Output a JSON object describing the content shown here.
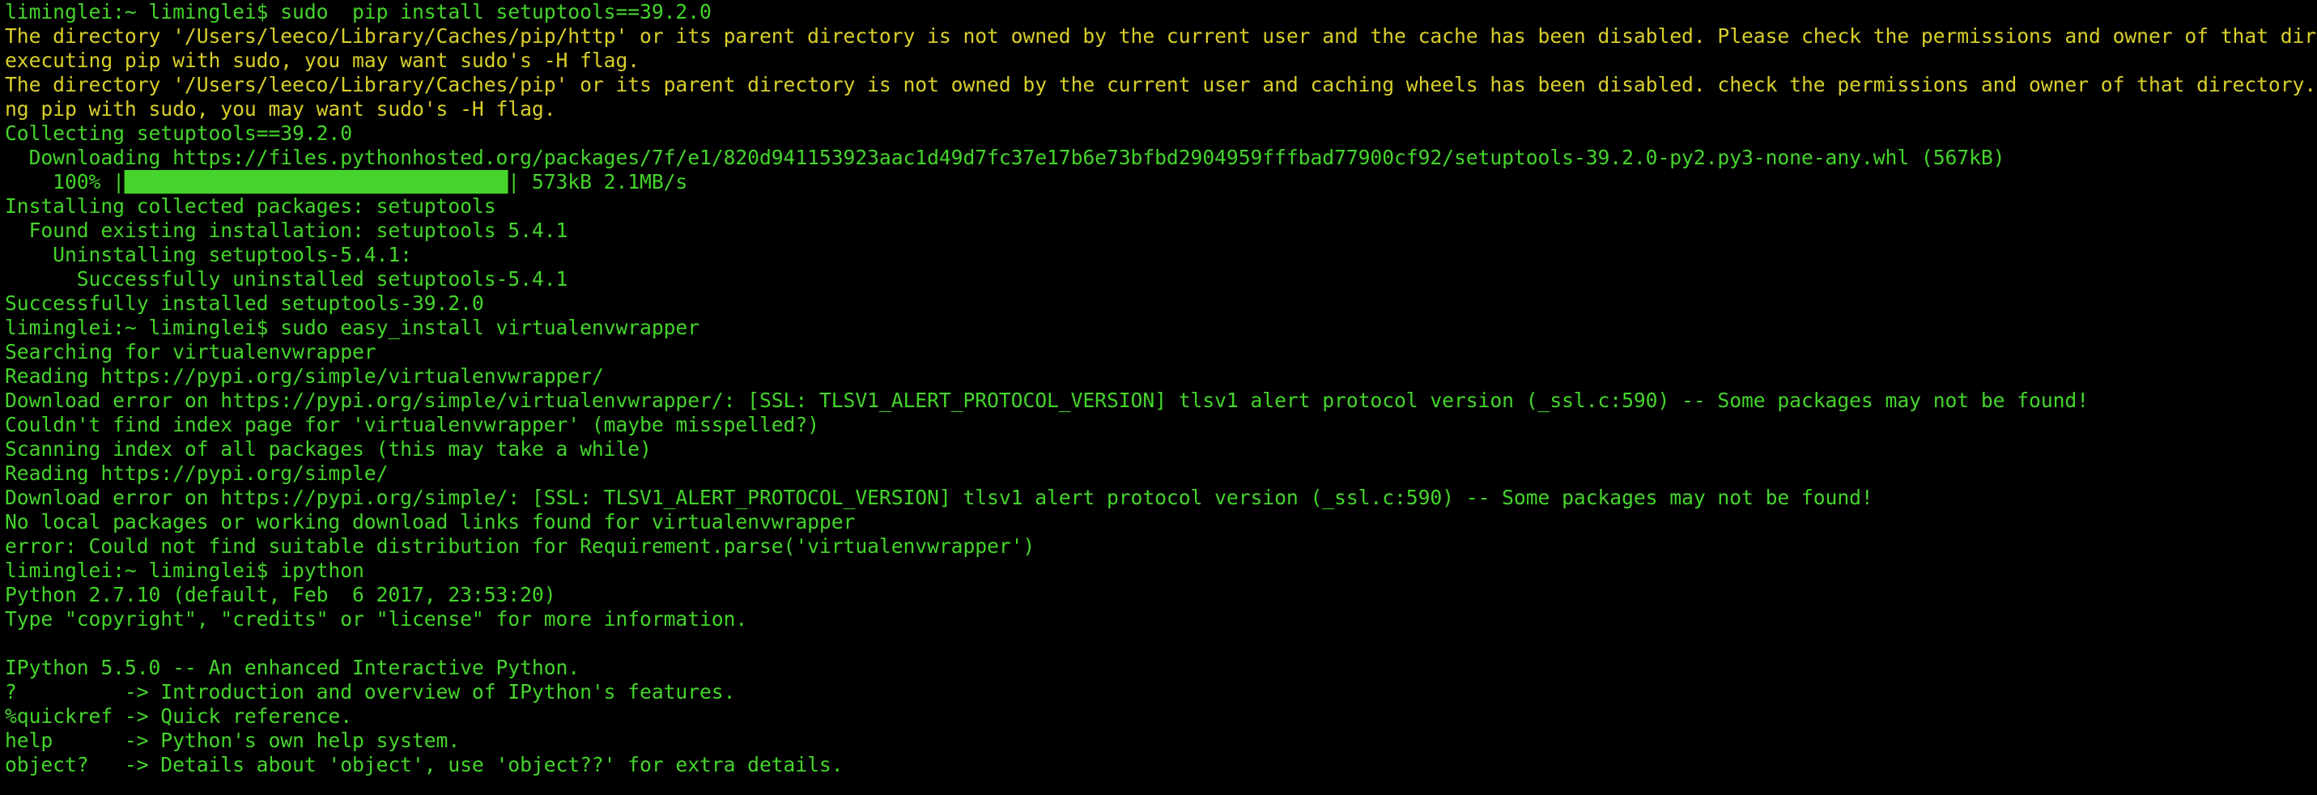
{
  "colors": {
    "background": "#000000",
    "output_green": "#45d42c",
    "warning_yellow": "#d8cf2a"
  },
  "lines": [
    {
      "text": "liminglei:~ liminglei$ sudo  pip install setuptools==39.2.0",
      "kind": "prompt"
    },
    {
      "text": "The directory '/Users/leeco/Library/Caches/pip/http' or its parent directory is not owned by the current user and the cache has been disabled. Please check the permissions and owner of that directory. If",
      "kind": "warn"
    },
    {
      "text": "executing pip with sudo, you may want sudo's -H flag.",
      "kind": "warn"
    },
    {
      "text": "The directory '/Users/leeco/Library/Caches/pip' or its parent directory is not owned by the current user and caching wheels has been disabled. check the permissions and owner of that directory. If executi",
      "kind": "warn"
    },
    {
      "text": "ng pip with sudo, you may want sudo's -H flag.",
      "kind": "warn"
    },
    {
      "text": "Collecting setuptools==39.2.0",
      "kind": "output"
    },
    {
      "text": "  Downloading https://files.pythonhosted.org/packages/7f/e1/820d941153923aac1d49d7fc37e17b6e73bfbd2904959fffbad77900cf92/setuptools-39.2.0-py2.py3-none-any.whl (567kB)",
      "kind": "output"
    },
    {
      "text": "    100% |████████████████████████████████| 573kB 2.1MB/s",
      "kind": "output"
    },
    {
      "text": "Installing collected packages: setuptools",
      "kind": "output"
    },
    {
      "text": "  Found existing installation: setuptools 5.4.1",
      "kind": "output"
    },
    {
      "text": "    Uninstalling setuptools-5.4.1:",
      "kind": "output"
    },
    {
      "text": "      Successfully uninstalled setuptools-5.4.1",
      "kind": "output"
    },
    {
      "text": "Successfully installed setuptools-39.2.0",
      "kind": "output"
    },
    {
      "text": "liminglei:~ liminglei$ sudo easy_install virtualenvwrapper",
      "kind": "prompt"
    },
    {
      "text": "Searching for virtualenvwrapper",
      "kind": "output"
    },
    {
      "text": "Reading https://pypi.org/simple/virtualenvwrapper/",
      "kind": "output"
    },
    {
      "text": "Download error on https://pypi.org/simple/virtualenvwrapper/: [SSL: TLSV1_ALERT_PROTOCOL_VERSION] tlsv1 alert protocol version (_ssl.c:590) -- Some packages may not be found!",
      "kind": "output"
    },
    {
      "text": "Couldn't find index page for 'virtualenvwrapper' (maybe misspelled?)",
      "kind": "output"
    },
    {
      "text": "Scanning index of all packages (this may take a while)",
      "kind": "output"
    },
    {
      "text": "Reading https://pypi.org/simple/",
      "kind": "output"
    },
    {
      "text": "Download error on https://pypi.org/simple/: [SSL: TLSV1_ALERT_PROTOCOL_VERSION] tlsv1 alert protocol version (_ssl.c:590) -- Some packages may not be found!",
      "kind": "output"
    },
    {
      "text": "No local packages or working download links found for virtualenvwrapper",
      "kind": "output"
    },
    {
      "text": "error: Could not find suitable distribution for Requirement.parse('virtualenvwrapper')",
      "kind": "output"
    },
    {
      "text": "liminglei:~ liminglei$ ipython",
      "kind": "prompt"
    },
    {
      "text": "Python 2.7.10 (default, Feb  6 2017, 23:53:20)",
      "kind": "output"
    },
    {
      "text": "Type \"copyright\", \"credits\" or \"license\" for more information.",
      "kind": "output"
    },
    {
      "text": "",
      "kind": "blank"
    },
    {
      "text": "IPython 5.5.0 -- An enhanced Interactive Python.",
      "kind": "output"
    },
    {
      "text": "?         -> Introduction and overview of IPython's features.",
      "kind": "output"
    },
    {
      "text": "%quickref -> Quick reference.",
      "kind": "output"
    },
    {
      "text": "help      -> Python's own help system.",
      "kind": "output"
    },
    {
      "text": "object?   -> Details about 'object', use 'object??' for extra details.",
      "kind": "output"
    }
  ]
}
